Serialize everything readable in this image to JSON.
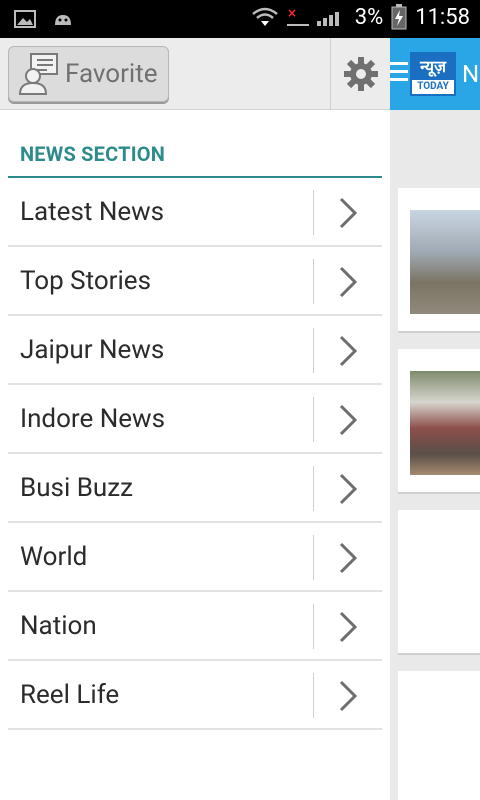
{
  "status_bar": {
    "battery": "3%",
    "time": "11:58"
  },
  "drawer": {
    "favorite_label": "Favorite",
    "section_title": "NEWS SECTION",
    "items": [
      {
        "label": "Latest News"
      },
      {
        "label": "Top Stories"
      },
      {
        "label": "Jaipur News"
      },
      {
        "label": "Indore News"
      },
      {
        "label": "Busi Buzz"
      },
      {
        "label": "World"
      },
      {
        "label": "Nation"
      },
      {
        "label": "Reel Life"
      }
    ]
  },
  "background_app": {
    "logo_top": "न्यूज़",
    "logo_bottom": "TODAY",
    "title_partial": "N"
  },
  "colors": {
    "accent": "#2e8b8b",
    "app_header": "#2aa6e6"
  }
}
